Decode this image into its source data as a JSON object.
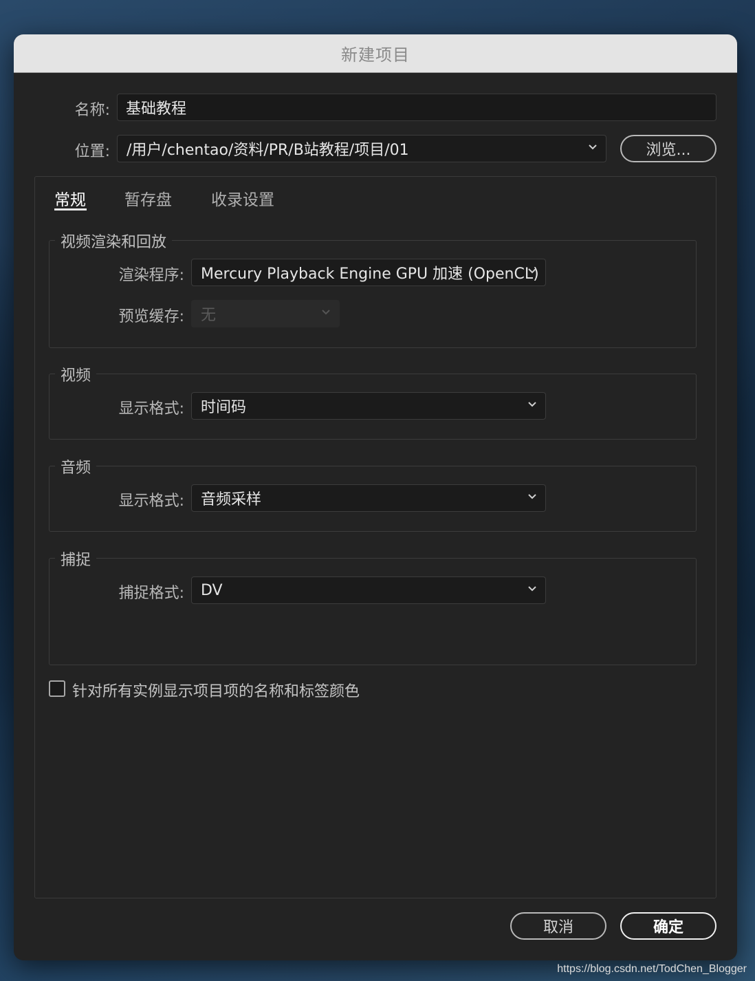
{
  "window": {
    "title": "新建项目"
  },
  "name_field": {
    "label": "名称:",
    "value": "基础教程"
  },
  "location_field": {
    "label": "位置:",
    "value": "/用户/chentao/资料/PR/B站教程/项目/01",
    "browse_label": "浏览..."
  },
  "tabs": [
    {
      "label": "常规",
      "active": true
    },
    {
      "label": "暂存盘",
      "active": false
    },
    {
      "label": "收录设置",
      "active": false
    }
  ],
  "video_rendering": {
    "title": "视频渲染和回放",
    "renderer": {
      "label": "渲染程序:",
      "value": "Mercury Playback Engine GPU 加速 (OpenCL)"
    },
    "preview_cache": {
      "label": "预览缓存:",
      "value": "无",
      "disabled": true
    }
  },
  "video": {
    "title": "视频",
    "display_format": {
      "label": "显示格式:",
      "value": "时间码"
    }
  },
  "audio": {
    "title": "音频",
    "display_format": {
      "label": "显示格式:",
      "value": "音频采样"
    }
  },
  "capture": {
    "title": "捕捉",
    "capture_format": {
      "label": "捕捉格式:",
      "value": "DV"
    }
  },
  "checkbox": {
    "label": "针对所有实例显示项目项的名称和标签颜色",
    "checked": false
  },
  "footer": {
    "cancel_label": "取消",
    "ok_label": "确定"
  },
  "watermark": "https://blog.csdn.net/TodChen_Blogger",
  "colors": {
    "dialog_bg": "#232323",
    "titlebar_bg": "#e4e4e4",
    "field_bg": "#191919"
  }
}
